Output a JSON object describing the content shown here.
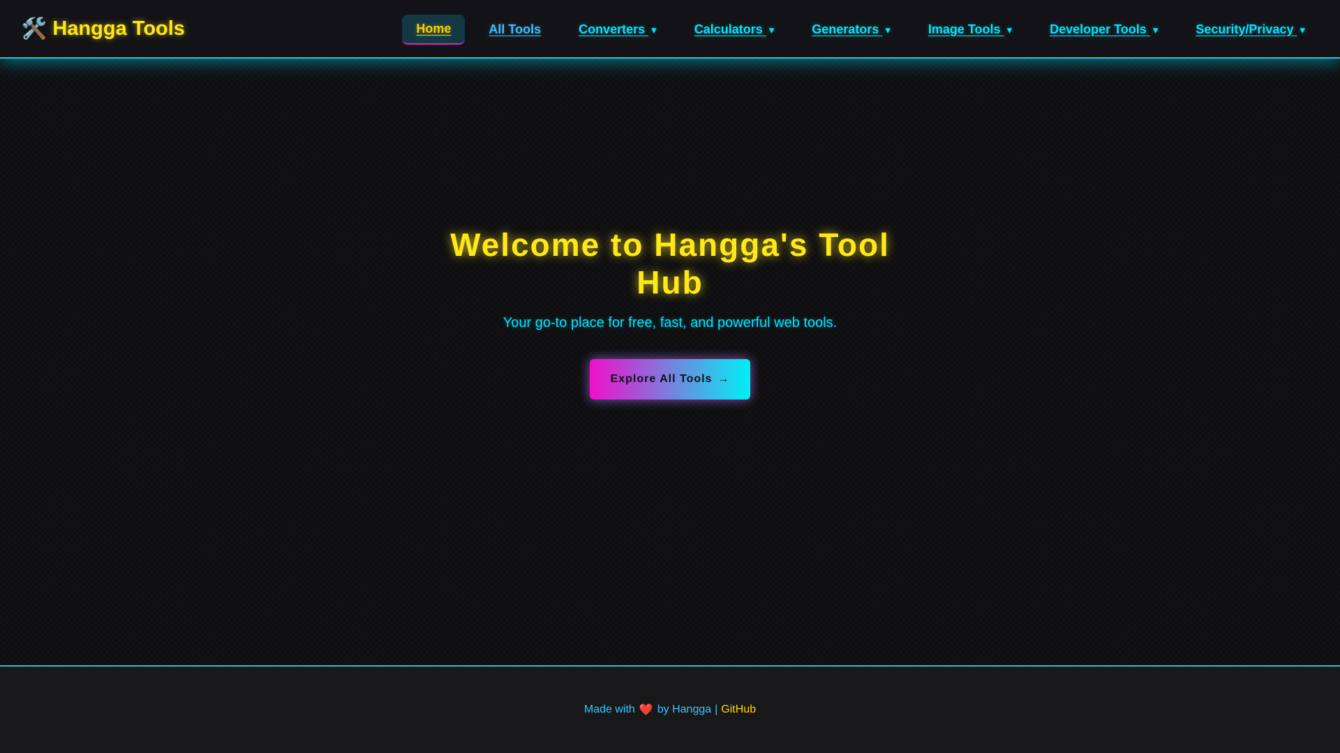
{
  "header": {
    "logo_icon": "🛠️",
    "logo_icon_name": "tools-icon",
    "logo_text": "Hangga Tools",
    "nav": {
      "home": "Home",
      "all_tools": "All Tools",
      "converters": "Converters",
      "calculators": "Calculators",
      "generators": "Generators",
      "image_tools": "Image Tools",
      "developer_tools": "Developer Tools",
      "security_privacy": "Security/Privacy",
      "caret": "▾"
    }
  },
  "hero": {
    "title": "Welcome to Hangga's Tool Hub",
    "subtitle": "Your go-to place for free, fast, and powerful web tools.",
    "cta_label": "Explore All Tools",
    "cta_arrow": "→"
  },
  "footer": {
    "made_with": "Made with",
    "heart": "❤️",
    "by_text": "by Hangga",
    "separator": "|",
    "github_link": "GitHub"
  },
  "colors": {
    "accent_cyan": "#00e5ff",
    "accent_yellow": "#ffe817",
    "accent_magenta": "#f010c8",
    "background": "#0e0e10"
  }
}
